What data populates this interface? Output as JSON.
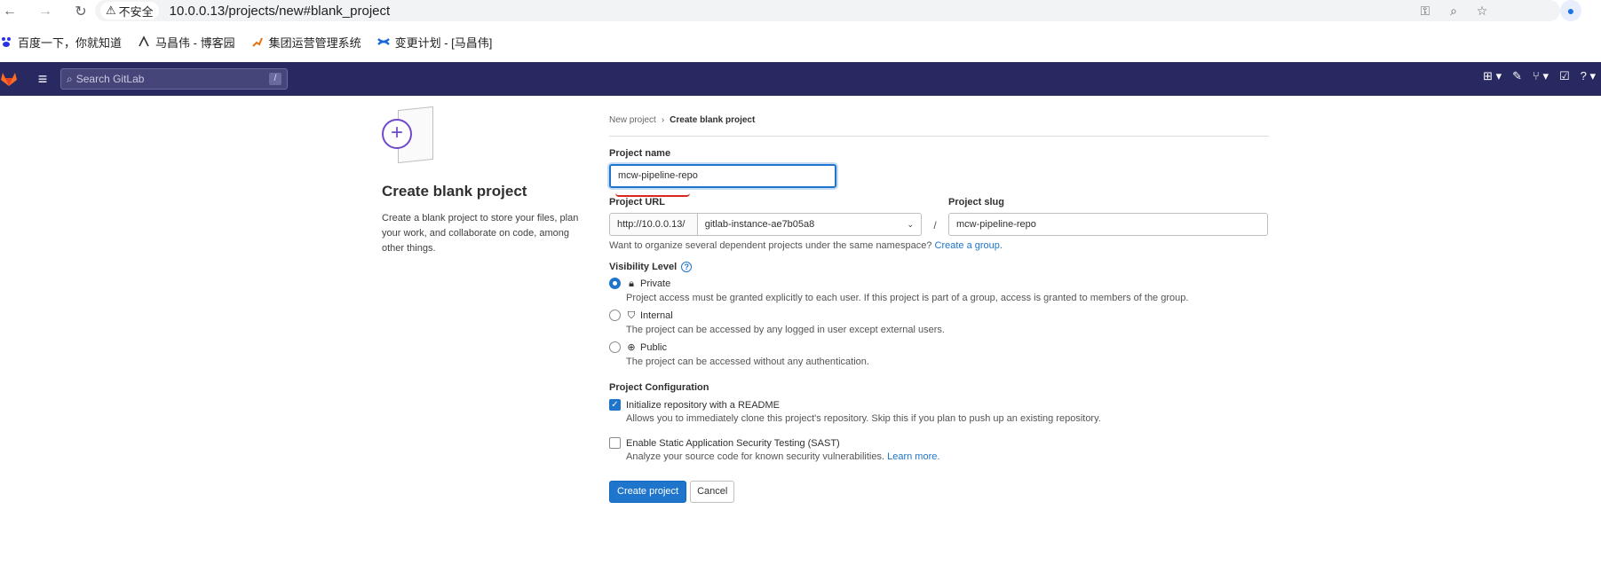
{
  "browser": {
    "insecure_label": "不安全",
    "url": "10.0.0.13/projects/new#blank_project",
    "bookmarks": [
      {
        "label": "百度一下，你就知道",
        "icon": "baidu-icon"
      },
      {
        "label": "马昌伟 - 博客园",
        "icon": "cnblogs-icon"
      },
      {
        "label": "集团运营管理系统",
        "icon": "ops-icon"
      },
      {
        "label": "变更计划 - [马昌伟]",
        "icon": "confluence-icon"
      }
    ]
  },
  "gitlab_header": {
    "search_placeholder": "Search GitLab",
    "search_shortcut": "/"
  },
  "left_panel": {
    "title": "Create blank project",
    "description": "Create a blank project to store your files, plan your work, and collaborate on code, among other things."
  },
  "breadcrumb": {
    "parent": "New project",
    "current": "Create blank project"
  },
  "form": {
    "project_name_label": "Project name",
    "project_name_value": "mcw-pipeline-repo",
    "project_url_label": "Project URL",
    "url_prefix": "http://10.0.0.13/",
    "namespace_value": "gitlab-instance-ae7b05a8",
    "slash": "/",
    "project_slug_label": "Project slug",
    "project_slug_value": "mcw-pipeline-repo",
    "namespace_help": "Want to organize several dependent projects under the same namespace?",
    "create_group_link": "Create a group.",
    "visibility_label": "Visibility Level",
    "visibility_options": [
      {
        "label": "Private",
        "desc": "Project access must be granted explicitly to each user. If this project is part of a group, access is granted to members of the group.",
        "checked": true
      },
      {
        "label": "Internal",
        "desc": "The project can be accessed by any logged in user except external users.",
        "checked": false
      },
      {
        "label": "Public",
        "desc": "The project can be accessed without any authentication.",
        "checked": false
      }
    ],
    "config_label": "Project Configuration",
    "readme_label": "Initialize repository with a README",
    "readme_desc": "Allows you to immediately clone this project's repository. Skip this if you plan to push up an existing repository.",
    "sast_label": "Enable Static Application Security Testing (SAST)",
    "sast_desc": "Analyze your source code for known security vulnerabilities.",
    "learn_more": "Learn more.",
    "create_button": "Create project",
    "cancel_button": "Cancel"
  },
  "colors": {
    "header_bg": "#292961",
    "primary": "#1f75cb",
    "accent_purple": "#6e49cb",
    "annotation_red": "#d9281e"
  }
}
